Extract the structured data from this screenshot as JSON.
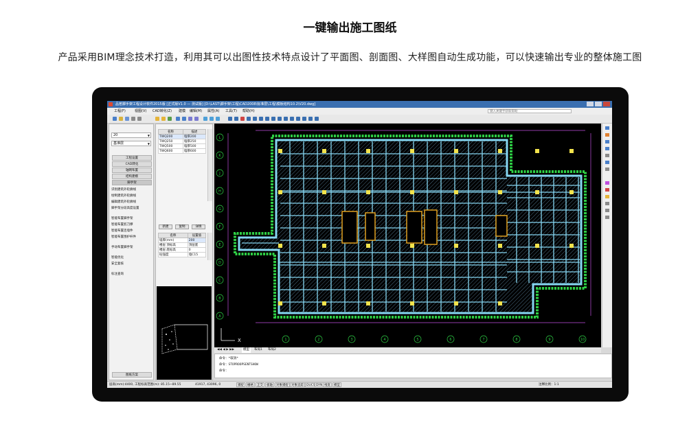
{
  "page": {
    "title": "一键输出施工图纸",
    "description": "产品采用BIM理念技术打造，利用其可以出图性技术特点设计了平面图、剖面图、大样图自动生成功能，可以快速输出专业的整体施工图"
  },
  "app": {
    "window_title": "品茗脚手架工程设计软件2015版 [正式版V1.0 — 测试版] [D:\\LAST\\脚手架\\工程\\CAD2008\\标准层\\工程\\模板结构10.2\\V20.dwg]",
    "menu": [
      "工程(F)",
      "视图(V)",
      "CAD转化(Z)",
      "建模",
      "编辑(M)",
      "属性(A)",
      "工具(T)",
      "帮助(H)"
    ],
    "help_placeholder": "键入关键字获取帮助"
  },
  "left_panel": {
    "floor_value": "20",
    "layer_value": "基准层",
    "categories": [
      "工程设置",
      "CAD转化",
      "轴网布置",
      "结构建模",
      "脚手架"
    ],
    "active_category": "脚手架",
    "commands_group1": [
      "识别建筑外轮廓线",
      "绘制建筑外轮廓线",
      "编辑建筑外轮廓线",
      "脚手架分段高度设置"
    ],
    "commands_group2": [
      "智能布置脚手架",
      "智能布置剪刀撑",
      "智能布置连墙件",
      "智能布置围护杆件"
    ],
    "commands_group3": [
      "手动布置脚手架"
    ],
    "commands_group4": [
      "智能优化",
      "安全复核"
    ],
    "commands_group5": [
      "标注查询"
    ],
    "bottom_button": "图纸方案"
  },
  "prop_panel": {
    "list_headers": [
      "名称",
      "描述"
    ],
    "list_rows": [
      [
        "TWQ200",
        "墙厚200"
      ],
      [
        "TWQ250",
        "墙厚250"
      ],
      [
        "TWQ500",
        "墙厚500"
      ],
      [
        "TWQ600",
        "墙厚600"
      ]
    ],
    "buttons": [
      "新建",
      "复制",
      "详情"
    ],
    "prop_headers": [
      "名称",
      "设置值"
    ],
    "prop_rows": [
      [
        "墙厚(mm)",
        "200"
      ],
      [
        "楼层 顶标高",
        "顶层底"
      ],
      [
        "楼层 底标高",
        "0"
      ],
      [
        "砼强度",
        "墙C15"
      ]
    ]
  },
  "canvas": {
    "left_axes": [
      "L",
      "K",
      "J",
      "H",
      "G",
      "F",
      "E",
      "D",
      "C",
      "B",
      "A"
    ],
    "bottom_axes": [
      "1",
      "2",
      "3",
      "4",
      "5",
      "6",
      "7",
      "8",
      "9",
      "10"
    ],
    "ucs_label": "X"
  },
  "layout_tabs": [
    "模型",
    "布局1",
    "布局2"
  ],
  "command_lines": [
    "命令：*取消*",
    "命令：STOPROOPSENTSHOW",
    "命令："
  ],
  "status": {
    "coords_label": "层高(mm):4400, 工程标高范围(m): 85.15~89.55",
    "coords_value": "41917, 43096, 0",
    "toggles": [
      "捕捉",
      "栅格",
      "正交",
      "极轴",
      "对象捕捉",
      "对象追踪",
      "DUCS",
      "DYN",
      "线宽",
      "模型"
    ],
    "annotation_scale": "注释比例：1:1"
  },
  "colors": {
    "cad_background": "#000000",
    "wall": "#86d7f2",
    "column": "#f2e34c",
    "frame": "#2ecf45",
    "dimension": "#c04ee0",
    "axis_bubble": "#2ecf45",
    "titlebar": "#3a6fb0"
  }
}
